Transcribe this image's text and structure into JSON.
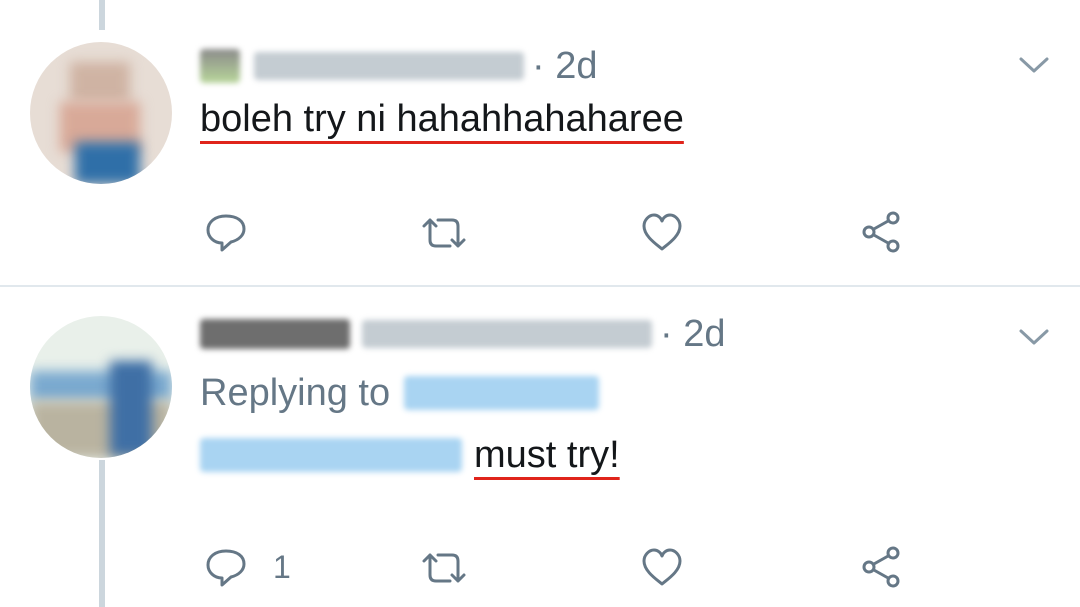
{
  "tweets": [
    {
      "timestamp": "· 2d",
      "text": "boleh try ni hahahhahaharee",
      "icons": [
        "reply-icon",
        "retweet-icon",
        "like-icon",
        "share-icon",
        "chevron-down-icon"
      ]
    },
    {
      "timestamp": "· 2d",
      "replying_to_label": "Replying to",
      "text": "must try!",
      "reply_count": "1",
      "icons": [
        "reply-icon",
        "retweet-icon",
        "like-icon",
        "share-icon",
        "chevron-down-icon"
      ]
    }
  ],
  "colors": {
    "text": "#14171a",
    "secondary": "#657786",
    "thread_line": "#ccd6dd",
    "mention_blur": "#a9d4f2",
    "underline": "#e0241b"
  }
}
